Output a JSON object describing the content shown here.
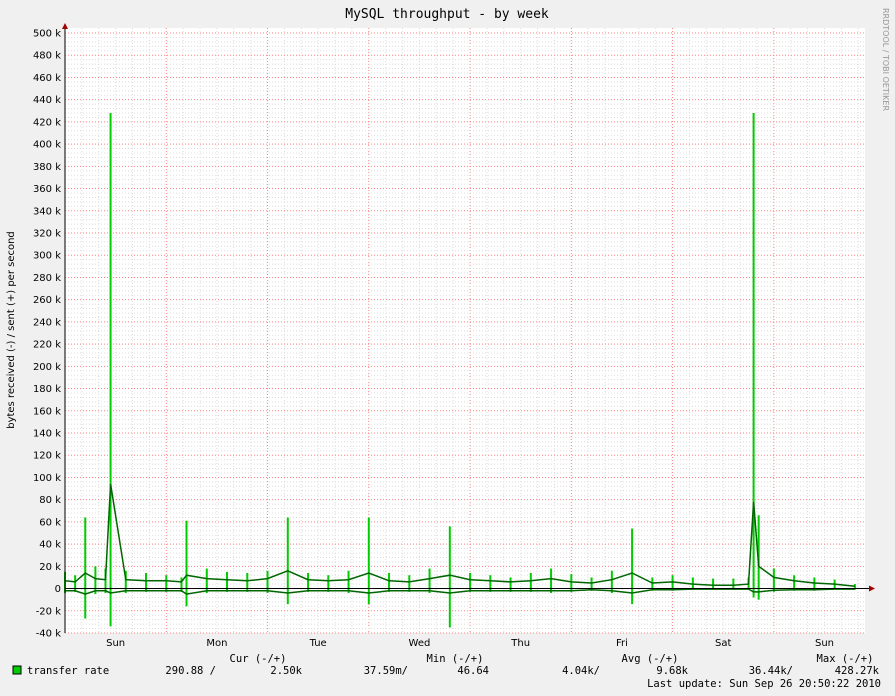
{
  "chart_data": {
    "type": "area",
    "title": "MySQL throughput - by week",
    "ylabel": "bytes received (-) / sent (+) per second",
    "xlabel": "",
    "watermark": "RRDTOOL / TOBI OETIKER",
    "ylim": [
      -40000,
      500000
    ],
    "yticks": [
      -40000,
      -20000,
      0,
      20000,
      40000,
      60000,
      80000,
      100000,
      120000,
      140000,
      160000,
      180000,
      200000,
      220000,
      240000,
      260000,
      280000,
      300000,
      320000,
      340000,
      360000,
      380000,
      400000,
      420000,
      440000,
      460000,
      480000,
      500000
    ],
    "ytick_labels": [
      "-40 k",
      "-20 k",
      "0",
      "20 k",
      "40 k",
      "60 k",
      "80 k",
      "100 k",
      "120 k",
      "140 k",
      "160 k",
      "180 k",
      "200 k",
      "220 k",
      "240 k",
      "260 k",
      "280 k",
      "300 k",
      "320 k",
      "340 k",
      "360 k",
      "380 k",
      "400 k",
      "420 k",
      "440 k",
      "460 k",
      "480 k",
      "500 k"
    ],
    "x_labels": [
      "Sun",
      "Mon",
      "Tue",
      "Wed",
      "Thu",
      "Fri",
      "Sat",
      "Sun"
    ],
    "xlim": [
      0,
      7.9
    ],
    "grid": true,
    "colors": {
      "series": "#00cc00",
      "series_line": "#006600",
      "background": "#ffffff",
      "minor_grid": "#dddddd",
      "major_grid": "#ff8080",
      "frame": "#f0f0f0"
    },
    "series": [
      {
        "name": "transfer rate",
        "x": [
          0,
          0.1,
          0.2,
          0.3,
          0.4,
          0.45,
          0.6,
          0.8,
          1.0,
          1.15,
          1.2,
          1.4,
          1.6,
          1.8,
          2.0,
          2.2,
          2.4,
          2.6,
          2.8,
          3.0,
          3.2,
          3.4,
          3.6,
          3.8,
          4.0,
          4.2,
          4.4,
          4.6,
          4.8,
          5.0,
          5.2,
          5.4,
          5.6,
          5.8,
          6.0,
          6.2,
          6.4,
          6.6,
          6.75,
          6.8,
          6.85,
          7.0,
          7.2,
          7.4,
          7.6,
          7.8
        ],
        "sent": [
          15000,
          12000,
          64000,
          20000,
          18000,
          428000,
          16000,
          14000,
          12000,
          10000,
          61000,
          18000,
          15000,
          14000,
          16000,
          64000,
          14000,
          12000,
          16000,
          64000,
          14000,
          12000,
          18000,
          56000,
          14000,
          12000,
          10000,
          14000,
          18000,
          13000,
          10000,
          16000,
          54000,
          10000,
          12000,
          10000,
          9000,
          9000,
          10000,
          428000,
          66000,
          18000,
          12000,
          10000,
          8000,
          4000
        ],
        "sent_avg": [
          7000,
          6000,
          14000,
          9000,
          8000,
          94000,
          8000,
          7000,
          7000,
          6000,
          12000,
          9000,
          8000,
          7000,
          9000,
          16000,
          8000,
          7000,
          8000,
          14000,
          7000,
          6000,
          9000,
          12000,
          8000,
          7000,
          6000,
          7000,
          9000,
          6000,
          5000,
          8000,
          14000,
          5000,
          6000,
          4000,
          3000,
          3000,
          4000,
          78000,
          20000,
          10000,
          7000,
          5000,
          4000,
          2000
        ],
        "received": [
          -4000,
          -3000,
          -27000,
          -5000,
          -4000,
          -34000,
          -4000,
          -3000,
          -3000,
          -3000,
          -16000,
          -4000,
          -3000,
          -3000,
          -4000,
          -14000,
          -3000,
          -3000,
          -4000,
          -14000,
          -3000,
          -3000,
          -4000,
          -35000,
          -3000,
          -3000,
          -3000,
          -3000,
          -4000,
          -3000,
          -2000,
          -4000,
          -14000,
          -2000,
          -2000,
          -1000,
          -1000,
          -1000,
          -1000,
          -8000,
          -10000,
          -3000,
          -2000,
          -2000,
          -1000,
          -1000
        ],
        "received_avg": [
          -2000,
          -2000,
          -5000,
          -2000,
          -2000,
          -4000,
          -2000,
          -2000,
          -2000,
          -2000,
          -5000,
          -2000,
          -2000,
          -2000,
          -2000,
          -4000,
          -2000,
          -2000,
          -2000,
          -4000,
          -2000,
          -2000,
          -2000,
          -4000,
          -2000,
          -2000,
          -2000,
          -2000,
          -2000,
          -2000,
          -1000,
          -2000,
          -4000,
          -1000,
          -1000,
          -500,
          -500,
          -500,
          -500,
          -3000,
          -3000,
          -1500,
          -1000,
          -1000,
          -500,
          -500
        ]
      }
    ],
    "legend": {
      "headers": [
        "Cur (-/+)",
        "Min (-/+)",
        "Avg (-/+)",
        "Max (-/+)"
      ],
      "name": "transfer rate",
      "values": [
        "290.88 /",
        "2.50k",
        "37.59m/",
        "46.64",
        "4.04k/",
        "9.68k",
        "36.44k/",
        "428.27k"
      ]
    },
    "last_update": "Last update:  Sun Sep 26 20:50:22 2010"
  }
}
